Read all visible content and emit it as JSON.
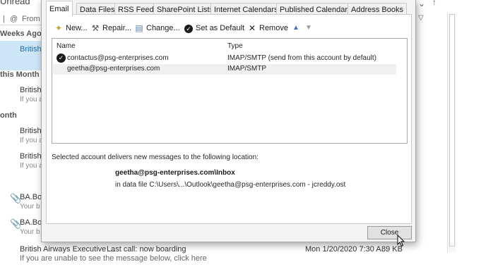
{
  "background": {
    "header_partial": "Unread",
    "filter_partial": [
      "|",
      "@",
      "From"
    ],
    "groups": [
      "Weeks Ago",
      "this Month",
      "onth"
    ],
    "items": [
      {
        "from": "British",
        "preview": "",
        "selected": true
      },
      {
        "from": "British ,",
        "preview": "If you a"
      },
      {
        "from": "British ,",
        "preview": "If you a"
      },
      {
        "from": "British ,",
        "preview": "If you a"
      },
      {
        "from": "BA.Boo",
        "preview": "Your b"
      },
      {
        "from": "BA.Boo",
        "preview": "Your b"
      }
    ],
    "bottom_row": {
      "from": "British Airways Executive ...",
      "subject": "Last call: now boarding",
      "date": "Mon 1/20/2020 7:30 A...",
      "size": "89 KB",
      "preview": "If you are unable to see the message below, click here"
    }
  },
  "dialog": {
    "tabs": [
      {
        "label": "Email",
        "active": true
      },
      {
        "label": "Data Files"
      },
      {
        "label": "RSS Feeds"
      },
      {
        "label": "SharePoint Lists"
      },
      {
        "label": "Internet Calendars"
      },
      {
        "label": "Published Calendars"
      },
      {
        "label": "Address Books"
      }
    ],
    "toolbar": {
      "new": "New...",
      "repair": "Repair...",
      "change": "Change...",
      "set_default": "Set as Default",
      "remove": "Remove"
    },
    "table": {
      "headers": [
        "Name",
        "Type"
      ],
      "rows": [
        {
          "name": "contactus@psg-enterprises.com",
          "type": "IMAP/SMTP (send from this account by default)",
          "default": true
        },
        {
          "name": "geetha@psg-enterprises.com",
          "type": "IMAP/SMTP",
          "default": false
        }
      ]
    },
    "delivery_label": "Selected account delivers new messages to the following location:",
    "delivery_path": "geetha@psg-enterprises.com\\Inbox",
    "delivery_file": "in data file C:\\Users\\...\\Outlook\\geetha@psg-enterprises.com - jcreddy.ost",
    "close_label": "Close"
  }
}
